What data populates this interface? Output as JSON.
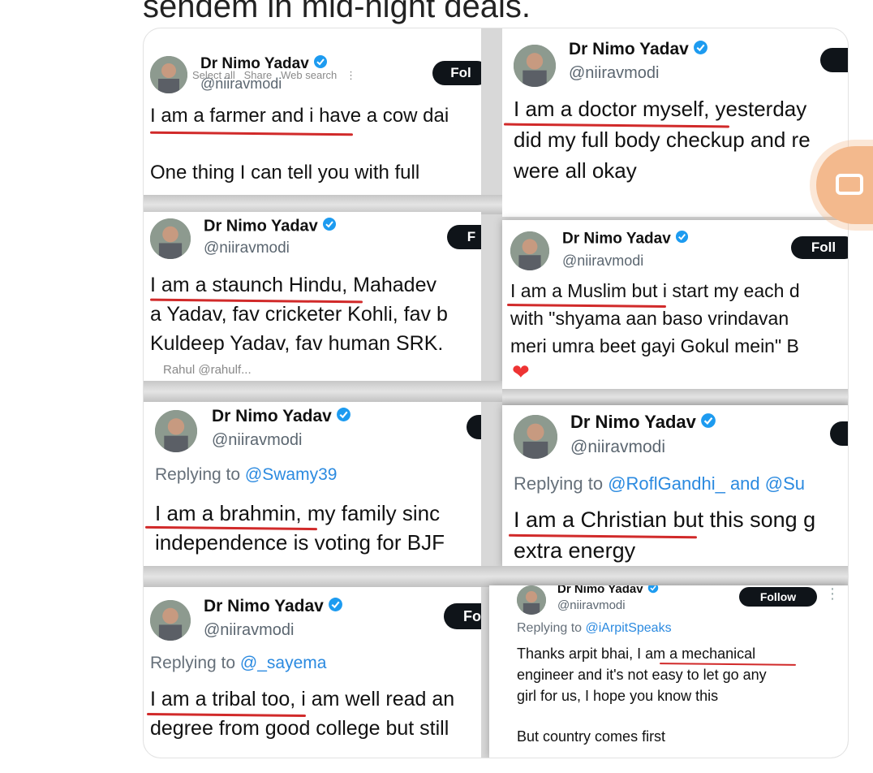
{
  "top_text": "sendem in mid-night deals.",
  "author": {
    "name": "Dr Nimo Yadav",
    "handle": "@niiravmodi"
  },
  "follow_label": "Follow",
  "follow_cut": {
    "t1": "Fol",
    "t3": "F",
    "t4": "Foll",
    "t7": "Fo"
  },
  "context_menu": [
    "Select all",
    "Share",
    "Web search"
  ],
  "tweets": [
    {
      "id": "farmer",
      "lines": [
        "I am a farmer and i have a cow dai",
        "",
        "One thing I can tell you with full"
      ]
    },
    {
      "id": "doctor",
      "lines": [
        "I am a doctor myself, yesterday",
        "did my full body checkup and re",
        "were all okay"
      ]
    },
    {
      "id": "hindu",
      "lines": [
        "I am a staunch Hindu, Mahadev",
        "a Yadav, fav cricketer Kohli, fav b",
        "Kuldeep Yadav, fav human SRK."
      ],
      "footer": "Rahul @rahulf..."
    },
    {
      "id": "muslim",
      "lines": [
        "I am a Muslim but i start my each d",
        "with \"shyama aan baso vrindavan",
        "meri umra beet gayi Gokul mein\" B"
      ],
      "emoji": "❤"
    },
    {
      "id": "brahmin",
      "replying_prefix": "Replying to",
      "replying_to": "@Swamy39",
      "lines": [
        "I am a brahmin, my family sinc",
        "independence is voting for BJF"
      ]
    },
    {
      "id": "christian",
      "replying_prefix": "Replying to",
      "replying_to": "@RoflGandhi_ and @Su",
      "lines": [
        "I am a Christian but this song g",
        "extra energy"
      ]
    },
    {
      "id": "tribal",
      "replying_prefix": "Replying to",
      "replying_to": "@_sayema",
      "lines": [
        "I am a tribal too, i am well read an",
        "degree from good college but still"
      ]
    },
    {
      "id": "mechanical",
      "replying_prefix": "Replying to",
      "replying_to": "@iArpitSpeaks",
      "lines": [
        "Thanks arpit bhai, I am a mechanical",
        "engineer and it's not easy to let go any",
        "girl  for us, I hope you know this",
        "",
        "But country comes first"
      ]
    }
  ],
  "colors": {
    "underline": "#d12a2a",
    "mention": "#2b8ae0",
    "verified": "#1d9bf0",
    "camera_button": "#f3b98d"
  },
  "icons": [
    "verified-badge-icon",
    "camera-icon",
    "heart-icon",
    "more-dots-icon"
  ]
}
